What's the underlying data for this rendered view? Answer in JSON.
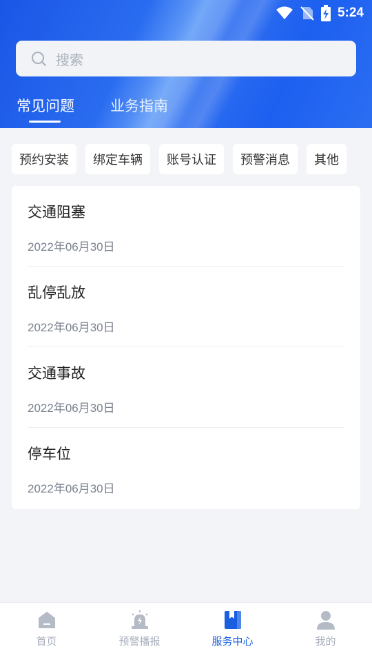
{
  "status_bar": {
    "time": "5:24",
    "icons": [
      "wifi-icon",
      "no-sim-icon",
      "battery-charging-icon"
    ]
  },
  "search": {
    "placeholder": "搜索",
    "icon": "search-icon"
  },
  "tabs": [
    {
      "label": "常见问题",
      "active": true
    },
    {
      "label": "业务指南",
      "active": false
    }
  ],
  "categories": [
    "预约安装",
    "绑定车辆",
    "账号认证",
    "预警消息",
    "其他"
  ],
  "items": [
    {
      "title": "交通阻塞",
      "date": "2022年06月30日"
    },
    {
      "title": "乱停乱放",
      "date": "2022年06月30日"
    },
    {
      "title": "交通事故",
      "date": "2022年06月30日"
    },
    {
      "title": "停车位",
      "date": "2022年06月30日"
    }
  ],
  "bottom_nav": [
    {
      "label": "首页",
      "icon": "home-icon",
      "active": false
    },
    {
      "label": "预警播报",
      "icon": "alarm-siren-icon",
      "active": false
    },
    {
      "label": "服务中心",
      "icon": "service-book-icon",
      "active": true
    },
    {
      "label": "我的",
      "icon": "user-icon",
      "active": false
    }
  ],
  "colors": {
    "primary": "#1a5fe0",
    "inactive": "#a7aebb",
    "background": "#f2f4f7"
  }
}
